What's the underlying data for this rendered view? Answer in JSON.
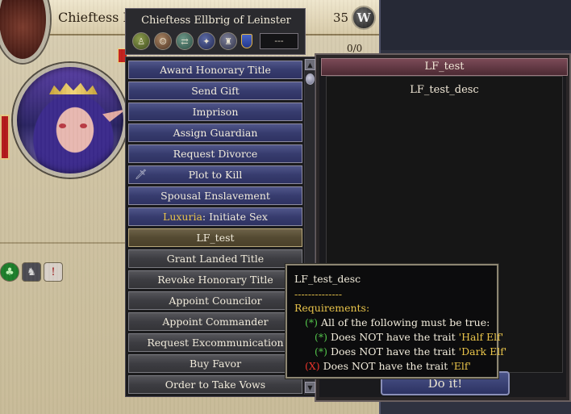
{
  "background_panel": {
    "character_name": "Chieftess Ellb",
    "age_value": "35",
    "badge_letter": "W",
    "ratio": "0/0"
  },
  "menu": {
    "title": "Chieftess Ellbrig of Leinster",
    "dropdown_value": "---",
    "items": [
      {
        "label": "Award Honorary Title",
        "state": "active"
      },
      {
        "label": "Send Gift",
        "state": "active"
      },
      {
        "label": "Imprison",
        "state": "active"
      },
      {
        "label": "Assign Guardian",
        "state": "active"
      },
      {
        "label": "Request Divorce",
        "state": "active"
      },
      {
        "label": "Plot to Kill",
        "state": "active"
      },
      {
        "label": "Spousal Enslavement",
        "state": "active"
      },
      {
        "label_prefix": "Luxuria",
        "label_suffix": ": Initiate Sex",
        "state": "active"
      },
      {
        "label": "LF_test",
        "state": "selected"
      },
      {
        "label": "Grant Landed Title",
        "state": "disabled"
      },
      {
        "label": "Revoke Honorary Title",
        "state": "disabled"
      },
      {
        "label": "Appoint Councilor",
        "state": "disabled"
      },
      {
        "label": "Appoint Commander",
        "state": "disabled"
      },
      {
        "label": "Request Excommunication",
        "state": "disabled"
      },
      {
        "label": "Buy Favor",
        "state": "disabled"
      },
      {
        "label": "Order to Take Vows",
        "state": "disabled"
      }
    ]
  },
  "detail": {
    "title": "LF_test",
    "description": "LF_test_desc",
    "action_button": "Do it!"
  },
  "tooltip": {
    "desc": "LF_test_desc",
    "separator": "--------------",
    "requirements_label": "Requirements:",
    "lines": [
      {
        "mark": "(*)",
        "text": " All of the following must be true:",
        "status": "met"
      },
      {
        "mark": "(*)",
        "text": " Does NOT have the trait ",
        "trait": "'Half Elf'",
        "status": "met"
      },
      {
        "mark": "(*)",
        "text": " Does NOT have the trait ",
        "trait": "'Dark Elf'",
        "status": "met"
      },
      {
        "mark": "(X)",
        "text": " Does NOT have the trait ",
        "trait": "'Elf'",
        "status": "failed"
      }
    ]
  },
  "colors": {
    "active_button": "#373c6e",
    "selected_button": "#544a32",
    "disabled_button": "#3d3d42",
    "highlight_yellow": "#e9c44a",
    "met_green": "#52c14a",
    "failed_red": "#e8342a"
  },
  "icons": {
    "menu_row": [
      "diplomacy-icon",
      "stewardship-icon",
      "martial-icon",
      "intrigue-icon",
      "learning-icon",
      "shield-icon"
    ],
    "traits": [
      "tree-icon",
      "trait-figure-icon",
      "trait-warning-icon"
    ]
  }
}
